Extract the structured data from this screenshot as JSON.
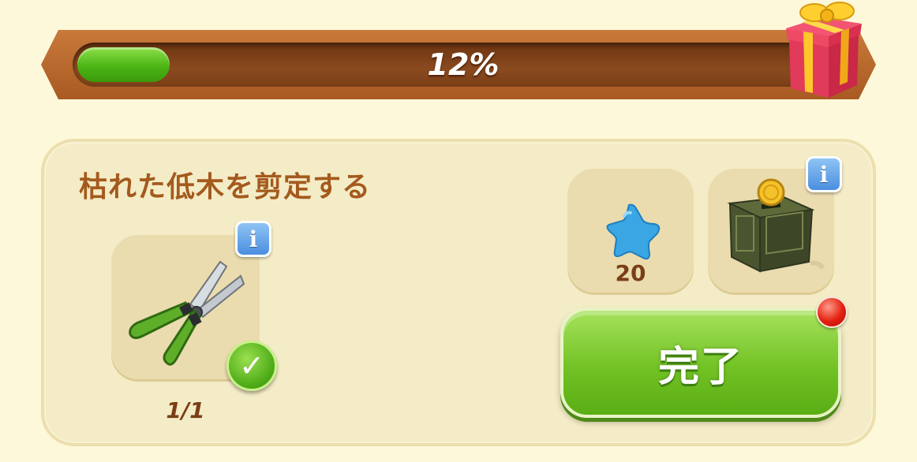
{
  "progress": {
    "label": "12%",
    "value_percent": 12,
    "fill_color": "#4cb515"
  },
  "reward_chest": {
    "icon": "gift-box-icon"
  },
  "task": {
    "title": "枯れた低木を剪定する",
    "requirement": {
      "icon": "pruning-shears-icon",
      "count": "1/1",
      "completed": true
    },
    "rewards": [
      {
        "icon": "blue-star-icon",
        "amount": "20"
      },
      {
        "icon": "coin-safe-box-icon"
      }
    ]
  },
  "complete_button": {
    "label": "完了",
    "has_notification": true
  },
  "colors": {
    "background": "#fdf8d9",
    "panel": "#f4ecc6",
    "title_text": "#a45a1e",
    "button_green": "#72c225",
    "info_blue": "#4b8ee0",
    "notify_red": "#e32010"
  }
}
